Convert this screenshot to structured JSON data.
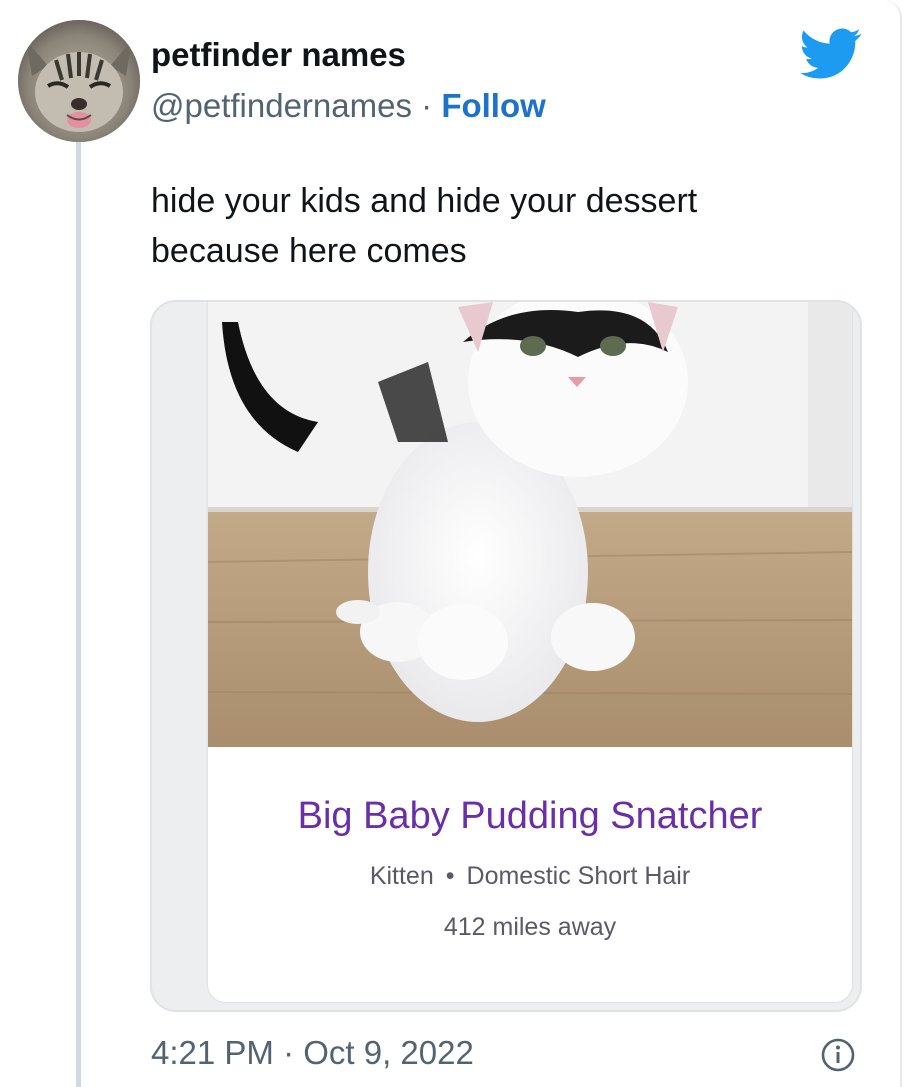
{
  "tweet": {
    "display_name": "petfinder names",
    "handle": "@petfindernames",
    "separator": "·",
    "follow_label": "Follow",
    "text_lines": [
      "hide your kids and hide your dessert",
      "because here comes"
    ],
    "timestamp": "4:21 PM · Oct 9, 2022",
    "icons": {
      "brand": "twitter-bird-icon",
      "info": "info-icon"
    },
    "colors": {
      "brand": "#1d9bf0",
      "link": "#1d72c9"
    }
  },
  "pet_card": {
    "name": "Big Baby Pudding Snatcher",
    "age": "Kitten",
    "meta_separator": "•",
    "breed": "Domestic Short Hair",
    "distance": "412 miles away",
    "name_color": "#6a2ea8"
  }
}
